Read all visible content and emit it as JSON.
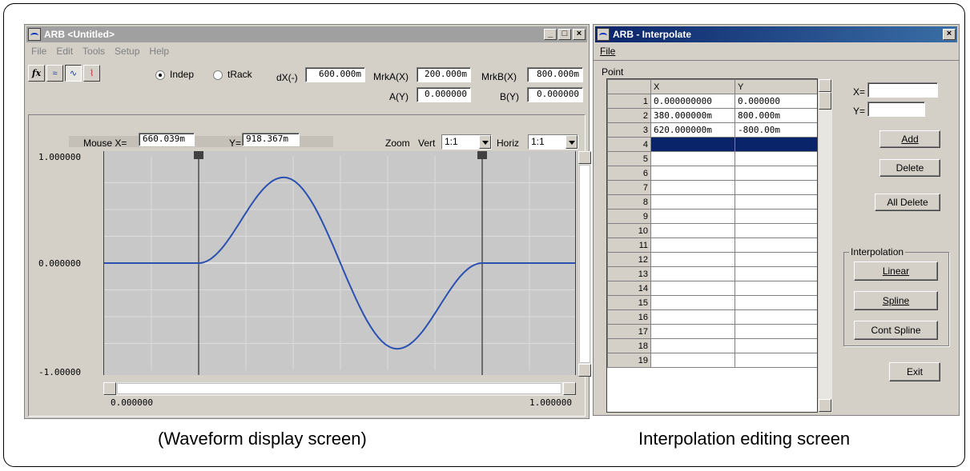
{
  "waveform_window": {
    "title": "ARB <Untitled>",
    "menu": [
      "File",
      "Edit",
      "Tools",
      "Setup",
      "Help"
    ],
    "toolbar": {
      "radio_indep": "Indep",
      "radio_track": "tRack",
      "dx_label": "dX(-)",
      "dx_value": "600.000m",
      "mrka_label": "MrkA(X)",
      "mrka_value": "200.000m",
      "ay_label": "A(Y)",
      "ay_value": "0.000000",
      "mrkb_label": "MrkB(X)",
      "mrkb_value": "800.000m",
      "by_label": "B(Y)",
      "by_value": "0.000000"
    },
    "plot_header": {
      "mouse_x_label": "Mouse X=",
      "mouse_x_value": "660.039m",
      "mouse_y_label": "Y=",
      "mouse_y_value": "918.367m",
      "zoom_label": "Zoom",
      "vert_label": "Vert",
      "vert_value": "1:1",
      "horiz_label": "Horiz",
      "horiz_value": "1:1"
    },
    "axis": {
      "y_top": "1.000000",
      "y_mid": "0.000000",
      "y_bottom": "-1.00000",
      "x_left": "0.000000",
      "x_right": "1.000000"
    },
    "waveform": {
      "x_range": [
        0,
        1
      ],
      "y_range": [
        -1,
        1
      ],
      "markers_x": [
        0.2,
        0.8
      ],
      "points": [
        [
          0,
          0
        ],
        [
          0.2,
          0
        ],
        [
          0.38,
          0.8
        ],
        [
          0.62,
          -0.8
        ],
        [
          0.8,
          0
        ],
        [
          1,
          0
        ]
      ],
      "line_color": "#2a50b0"
    }
  },
  "interpolate_window": {
    "title": "ARB - Interpolate",
    "menu": [
      "File"
    ],
    "point_label": "Point",
    "columns": [
      "X",
      "Y"
    ],
    "rows": [
      {
        "n": "1",
        "x": "0.000000000",
        "y": "0.000000"
      },
      {
        "n": "2",
        "x": "380.000000m",
        "y": "800.000m"
      },
      {
        "n": "3",
        "x": "620.000000m",
        "y": "-800.00m"
      },
      {
        "n": "4",
        "x": "",
        "y": ""
      },
      {
        "n": "5",
        "x": "",
        "y": ""
      },
      {
        "n": "6",
        "x": "",
        "y": ""
      },
      {
        "n": "7",
        "x": "",
        "y": ""
      },
      {
        "n": "8",
        "x": "",
        "y": ""
      },
      {
        "n": "9",
        "x": "",
        "y": ""
      },
      {
        "n": "10",
        "x": "",
        "y": ""
      },
      {
        "n": "11",
        "x": "",
        "y": ""
      },
      {
        "n": "12",
        "x": "",
        "y": ""
      },
      {
        "n": "13",
        "x": "",
        "y": ""
      },
      {
        "n": "14",
        "x": "",
        "y": ""
      },
      {
        "n": "15",
        "x": "",
        "y": ""
      },
      {
        "n": "16",
        "x": "",
        "y": ""
      },
      {
        "n": "17",
        "x": "",
        "y": ""
      },
      {
        "n": "18",
        "x": "",
        "y": ""
      },
      {
        "n": "19",
        "x": "",
        "y": ""
      }
    ],
    "selected_row": "4",
    "x_field_label": "X=",
    "y_field_label": "Y=",
    "add_button": "Add",
    "delete_button": "Delete",
    "all_delete_button": "All Delete",
    "interpolation_group": "Interpolation",
    "linear_button": "Linear",
    "spline_button": "Spline",
    "cont_spline_button": "Cont Spline",
    "exit_button": "Exit"
  },
  "captions": {
    "left": "(Waveform display screen)",
    "right": "Interpolation editing screen"
  }
}
